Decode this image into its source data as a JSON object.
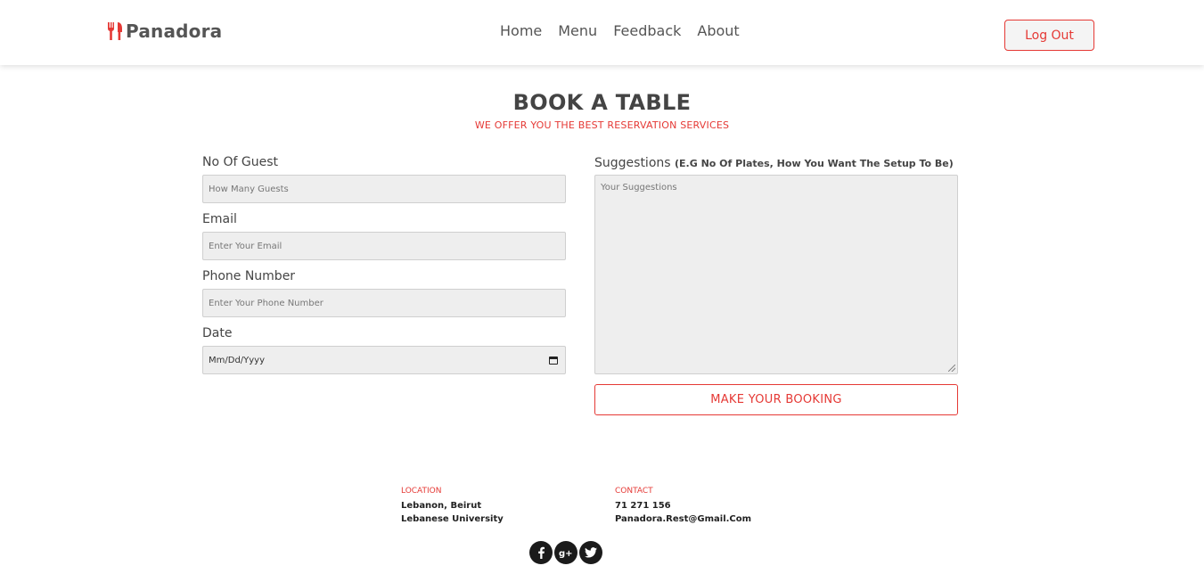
{
  "header": {
    "brand": "Panadora",
    "nav": [
      "Home",
      "Menu",
      "Feedback",
      "About"
    ],
    "logout_label": "Log Out"
  },
  "booking": {
    "title": "BOOK A TABLE",
    "subtitle": "WE OFFER YOU THE BEST RESERVATION SERVICES",
    "guests_label": "No Of Guest",
    "guests_placeholder": "How Many Guests",
    "email_label": "Email",
    "email_placeholder": "Enter Your Email",
    "phone_label": "Phone Number",
    "phone_placeholder": "Enter Your Phone Number",
    "date_label": "Date",
    "date_value": "Mm/Dd/Yyyy",
    "suggestions_label": "Suggestions",
    "suggestions_hint": "(E.G No Of Plates, How You Want The Setup To Be)",
    "suggestions_placeholder": "Your Suggestions",
    "submit_label": "MAKE YOUR BOOKING"
  },
  "footer": {
    "location_heading": "LOCATION",
    "location_line1": "Lebanon, Beirut",
    "location_line2": "Lebanese University",
    "contact_heading": "CONTACT",
    "contact_phone": "71 271 156",
    "contact_email": "Panadora.Rest@Gmail.Com",
    "social_icons": [
      "facebook-icon",
      "google-plus-icon",
      "twitter-icon"
    ]
  },
  "colors": {
    "accent": "#e53935",
    "input_bg": "#eeeeee",
    "text": "#444444"
  }
}
